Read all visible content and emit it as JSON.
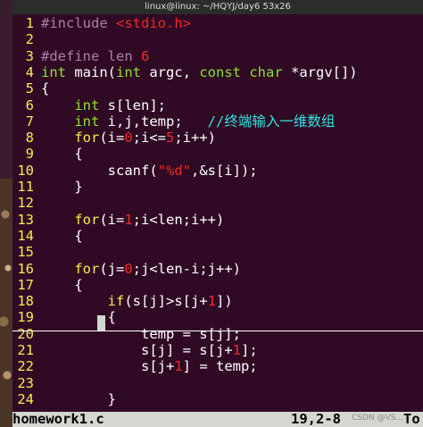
{
  "window": {
    "title": "linux@linux: ~/HQYJ/day6 53x26"
  },
  "editor": {
    "lines": [
      {
        "n": "1",
        "tokens": [
          [
            "pp",
            "#include "
          ],
          [
            "st",
            "<stdio.h>"
          ]
        ]
      },
      {
        "n": "2",
        "tokens": []
      },
      {
        "n": "3",
        "tokens": [
          [
            "pp",
            "#define len "
          ],
          [
            "num",
            "6"
          ]
        ]
      },
      {
        "n": "4",
        "tokens": [
          [
            "ty",
            "int"
          ],
          [
            "kw",
            " main("
          ],
          [
            "ty",
            "int"
          ],
          [
            "kw",
            " argc, "
          ],
          [
            "ty",
            "const char"
          ],
          [
            "kw",
            " *argv[])"
          ]
        ]
      },
      {
        "n": "5",
        "tokens": [
          [
            "kw",
            "{"
          ]
        ]
      },
      {
        "n": "6",
        "tokens": [
          [
            "kw",
            "    "
          ],
          [
            "ty",
            "int"
          ],
          [
            "kw",
            " s[len];"
          ]
        ]
      },
      {
        "n": "7",
        "tokens": [
          [
            "kw",
            "    "
          ],
          [
            "ty",
            "int"
          ],
          [
            "kw",
            " i,j,temp;   "
          ],
          [
            "cm",
            "//终端输入一维数组"
          ]
        ]
      },
      {
        "n": "8",
        "tokens": [
          [
            "kw",
            "    "
          ],
          [
            "ctl",
            "for"
          ],
          [
            "kw",
            "(i="
          ],
          [
            "num",
            "0"
          ],
          [
            "kw",
            ";i<="
          ],
          [
            "num",
            "5"
          ],
          [
            "kw",
            ";i++)"
          ]
        ]
      },
      {
        "n": "9",
        "tokens": [
          [
            "kw",
            "    {"
          ]
        ]
      },
      {
        "n": "10",
        "tokens": [
          [
            "kw",
            "        scanf("
          ],
          [
            "st",
            "\"%d\""
          ],
          [
            "kw",
            ",&s[i]);"
          ]
        ]
      },
      {
        "n": "11",
        "tokens": [
          [
            "kw",
            "    }"
          ]
        ]
      },
      {
        "n": "12",
        "tokens": []
      },
      {
        "n": "13",
        "tokens": [
          [
            "kw",
            "    "
          ],
          [
            "ctl",
            "for"
          ],
          [
            "kw",
            "(i="
          ],
          [
            "num",
            "1"
          ],
          [
            "kw",
            ";i<len;i++)"
          ]
        ]
      },
      {
        "n": "14",
        "tokens": [
          [
            "kw",
            "    {"
          ]
        ]
      },
      {
        "n": "15",
        "tokens": []
      },
      {
        "n": "16",
        "tokens": [
          [
            "kw",
            "    "
          ],
          [
            "ctl",
            "for"
          ],
          [
            "kw",
            "(j="
          ],
          [
            "num",
            "0"
          ],
          [
            "kw",
            ";j<len-i;j++)"
          ]
        ]
      },
      {
        "n": "17",
        "tokens": [
          [
            "kw",
            "    {"
          ]
        ]
      },
      {
        "n": "18",
        "tokens": [
          [
            "kw",
            "        "
          ],
          [
            "ctl",
            "if"
          ],
          [
            "kw",
            "(s[j]>s[j+"
          ],
          [
            "num",
            "1"
          ],
          [
            "kw",
            "])"
          ]
        ]
      },
      {
        "n": "19",
        "tokens": [
          [
            "kw",
            "        {"
          ]
        ]
      },
      {
        "n": "20",
        "tokens": [
          [
            "kw",
            "            temp = s[j];"
          ]
        ]
      },
      {
        "n": "21",
        "tokens": [
          [
            "kw",
            "            s[j] = s[j+"
          ],
          [
            "num",
            "1"
          ],
          [
            "kw",
            "];"
          ]
        ]
      },
      {
        "n": "22",
        "tokens": [
          [
            "kw",
            "            s[j+"
          ],
          [
            "num",
            "1"
          ],
          [
            "kw",
            "] = temp;"
          ]
        ]
      },
      {
        "n": "23",
        "tokens": []
      },
      {
        "n": "24",
        "tokens": [
          [
            "kw",
            "        }"
          ]
        ]
      }
    ]
  },
  "statusbar": {
    "filename": "homework1.c",
    "position": "19,2-8",
    "percent": "To"
  },
  "watermark": "CSDN @VS..."
}
